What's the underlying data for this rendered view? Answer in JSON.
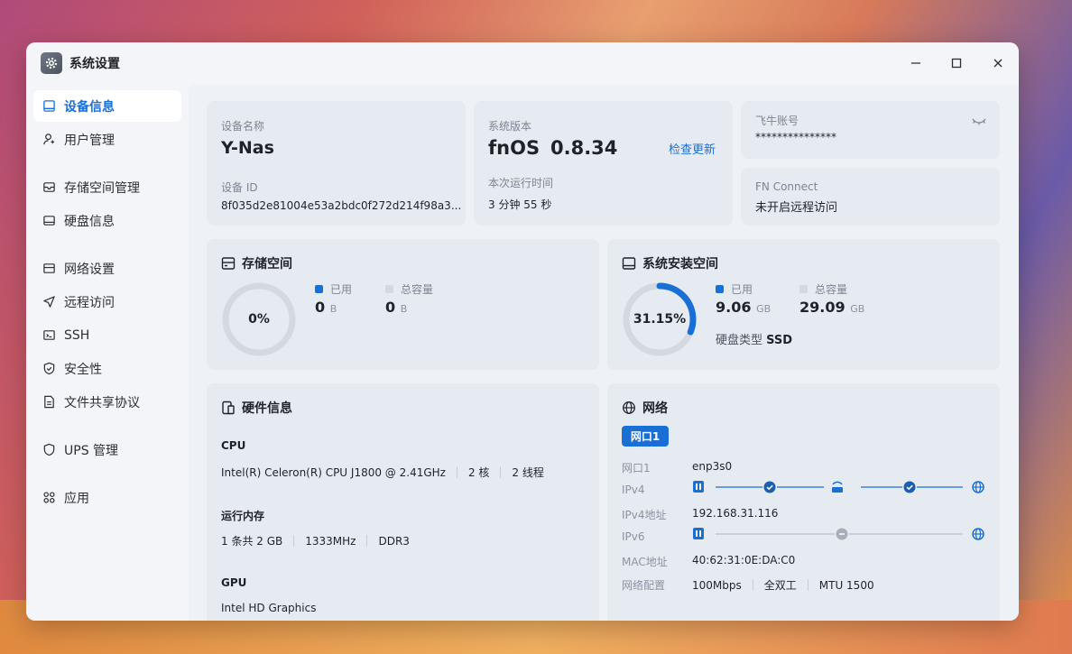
{
  "window": {
    "title": "系统设置",
    "icon": "gear-icon"
  },
  "sidebar": {
    "items": [
      {
        "label": "设备信息",
        "icon": "device-icon",
        "active": true
      },
      {
        "label": "用户管理",
        "icon": "user-icon"
      },
      {
        "label": "存储空间管理",
        "icon": "storage-icon"
      },
      {
        "label": "硬盘信息",
        "icon": "disk-icon"
      },
      {
        "label": "网络设置",
        "icon": "network-icon"
      },
      {
        "label": "远程访问",
        "icon": "send-icon"
      },
      {
        "label": "SSH",
        "icon": "terminal-icon"
      },
      {
        "label": "安全性",
        "icon": "shield-icon"
      },
      {
        "label": "文件共享协议",
        "icon": "file-icon"
      },
      {
        "label": "UPS 管理",
        "icon": "ups-shield-icon"
      },
      {
        "label": "应用",
        "icon": "apps-icon"
      }
    ]
  },
  "device": {
    "name_label": "设备名称",
    "name": "Y-Nas",
    "id_label": "设备 ID",
    "id": "8f035d2e81004e53a2bdc0f272d214f98a3..."
  },
  "system": {
    "version_label": "系统版本",
    "os": "fnOS",
    "version": "0.8.34",
    "check_update": "检查更新",
    "uptime_label": "本次运行时间",
    "uptime": "3 分钟 55 秒"
  },
  "account": {
    "label": "飞牛账号",
    "value": "***************",
    "icon": "eye-closed-icon"
  },
  "fn_connect": {
    "label": "FN Connect",
    "value": "未开启远程访问"
  },
  "storage": {
    "title": "存储空间",
    "percent_text": "0%",
    "percent": 0,
    "used_label": "已用",
    "used": "0",
    "used_unit": "B",
    "total_label": "总容量",
    "total": "0",
    "total_unit": "B"
  },
  "sys_install": {
    "title": "系统安装空间",
    "percent_text": "31.15%",
    "percent": 31.15,
    "used_label": "已用",
    "used": "9.06",
    "used_unit": "GB",
    "total_label": "总容量",
    "total": "29.09",
    "total_unit": "GB",
    "disk_type_label": "硬盘类型",
    "disk_type": "SSD"
  },
  "hardware": {
    "title": "硬件信息",
    "cpu_label": "CPU",
    "cpu": "Intel(R) Celeron(R) CPU J1800 @ 2.41GHz",
    "cores": "2 核",
    "threads": "2 线程",
    "ram_label": "运行内存",
    "ram": "1 条共 2 GB",
    "ram_speed": "1333MHz",
    "ram_type": "DDR3",
    "gpu_label": "GPU",
    "gpu": "Intel HD Graphics"
  },
  "network": {
    "title": "网络",
    "tab": "网口1",
    "port_label": "网口1",
    "port": "enp3s0",
    "ipv4_label": "IPv4",
    "ipv4_addr_label": "IPv4地址",
    "ipv4_addr": "192.168.31.116",
    "ipv6_label": "IPv6",
    "mac_label": "MAC地址",
    "mac": "40:62:31:0E:DA:C0",
    "config_label": "网络配置",
    "speed": "100Mbps",
    "duplex": "全双工",
    "mtu": "MTU 1500"
  },
  "colors": {
    "accent": "#1a6fd4",
    "ring_bg": "#d4d9e0"
  }
}
